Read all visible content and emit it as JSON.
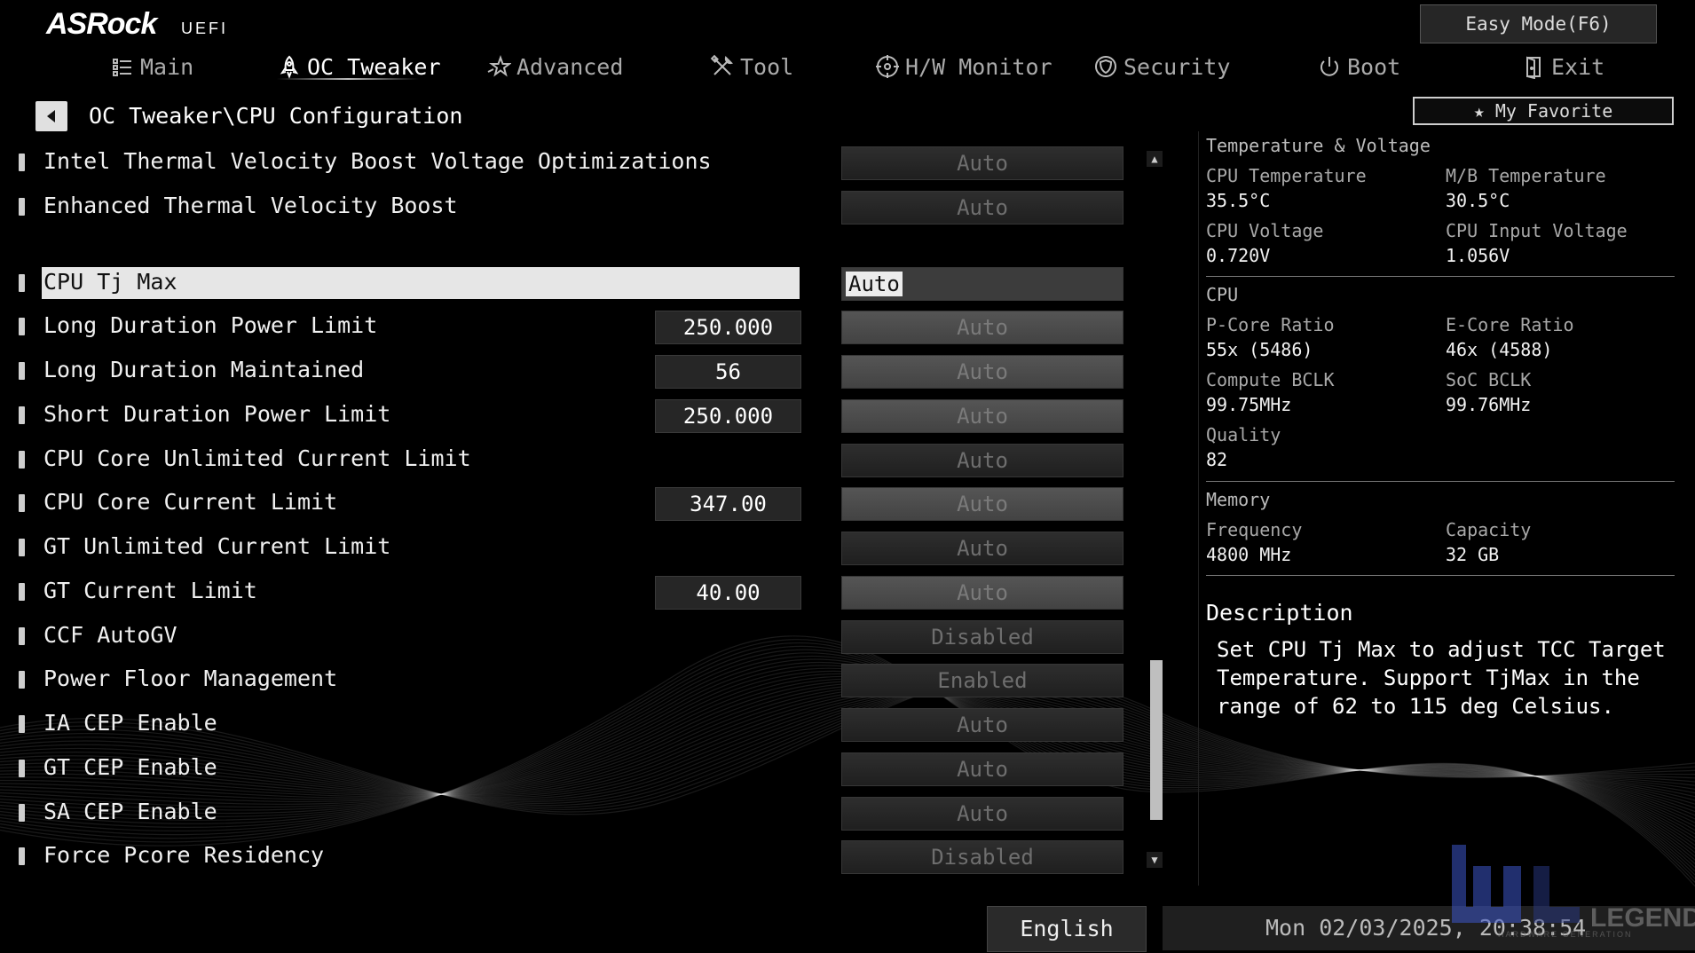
{
  "header": {
    "brand": "ASRock",
    "brand_suffix": "UEFI",
    "easy_mode_label": "Easy Mode(F6)"
  },
  "nav": {
    "tabs": [
      {
        "label": "Main",
        "icon": "list-icon"
      },
      {
        "label": "OC Tweaker",
        "icon": "rocket-icon",
        "active": true
      },
      {
        "label": "Advanced",
        "icon": "star-icon"
      },
      {
        "label": "Tool",
        "icon": "tools-icon"
      },
      {
        "label": "H/W Monitor",
        "icon": "monitor-icon"
      },
      {
        "label": "Security",
        "icon": "shield-icon"
      },
      {
        "label": "Boot",
        "icon": "power-icon"
      },
      {
        "label": "Exit",
        "icon": "exit-icon"
      }
    ]
  },
  "breadcrumb": "OC Tweaker\\CPU Configuration",
  "favorite_label": "My Favorite",
  "settings": [
    {
      "label": "Intel Thermal Velocity Boost Voltage Optimizations",
      "value": "Auto"
    },
    {
      "label": "Enhanced Thermal Velocity Boost",
      "value": "Auto"
    },
    {
      "label": "CPU Tj Max",
      "value": "Auto",
      "selected": true
    },
    {
      "label": "Long Duration Power Limit",
      "number": "250.000",
      "value": "Auto"
    },
    {
      "label": "Long Duration Maintained",
      "number": "56",
      "value": "Auto"
    },
    {
      "label": "Short Duration Power Limit",
      "number": "250.000",
      "value": "Auto"
    },
    {
      "label": "CPU Core Unlimited Current Limit",
      "value": "Auto"
    },
    {
      "label": "CPU Core Current Limit",
      "number": "347.00",
      "value": "Auto"
    },
    {
      "label": "GT Unlimited Current Limit",
      "value": "Auto"
    },
    {
      "label": "GT Current Limit",
      "number": "40.00",
      "value": "Auto"
    },
    {
      "label": "CCF AutoGV",
      "value": "Disabled"
    },
    {
      "label": "Power Floor Management",
      "value": "Enabled"
    },
    {
      "label": "IA CEP Enable",
      "value": "Auto"
    },
    {
      "label": "GT CEP Enable",
      "value": "Auto"
    },
    {
      "label": "SA CEP Enable",
      "value": "Auto"
    },
    {
      "label": "Force Pcore Residency",
      "value": "Disabled"
    }
  ],
  "scrollbar": {
    "position_fraction": 0.8
  },
  "panel": {
    "temp_voltage_title": "Temperature & Voltage",
    "cpu_temp_label": "CPU Temperature",
    "cpu_temp": "35.5°C",
    "mb_temp_label": "M/B Temperature",
    "mb_temp": "30.5°C",
    "cpu_volt_label": "CPU Voltage",
    "cpu_volt": "0.720V",
    "cpu_input_volt_label": "CPU Input Voltage",
    "cpu_input_volt": "1.056V",
    "cpu_title": "CPU",
    "pcore_label": "P-Core Ratio",
    "pcore": "55x (5486)",
    "ecore_label": "E-Core Ratio",
    "ecore": "46x (4588)",
    "compute_bclk_label": "Compute BCLK",
    "compute_bclk": "99.75MHz",
    "soc_bclk_label": "SoC BCLK",
    "soc_bclk": "99.76MHz",
    "quality_label": "Quality",
    "quality": "82",
    "memory_title": "Memory",
    "freq_label": "Frequency",
    "freq": "4800 MHz",
    "capacity_label": "Capacity",
    "capacity": "32 GB",
    "description_title": "Description",
    "description": "Set CPU Tj Max to adjust TCC Target Temperature. Support TjMax in the range of 62 to 115 deg Celsius."
  },
  "footer": {
    "language": "English",
    "datetime": "Mon 02/03/2025, 20:38:54"
  },
  "watermark": {
    "text": "LEGEND",
    "subtext": "HARDWARE GENERATION"
  },
  "colors": {
    "background": "#000000",
    "selected_row": "#e6e6e6",
    "value_box": "#262626"
  }
}
